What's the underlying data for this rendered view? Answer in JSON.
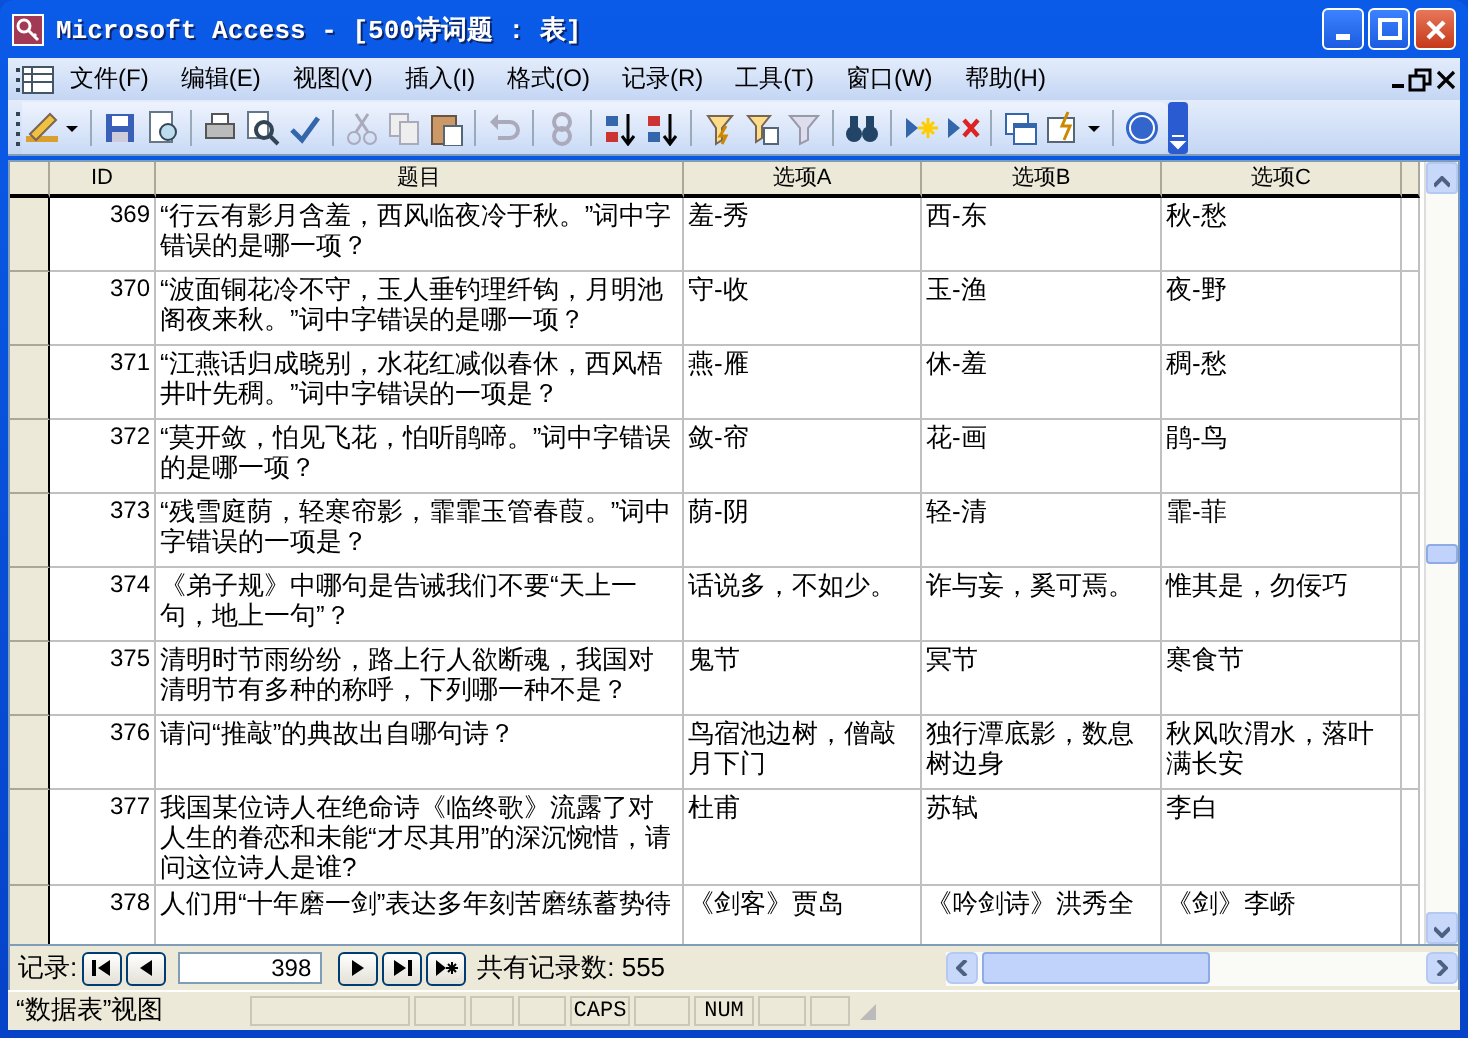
{
  "window": {
    "title": "Microsoft Access - [500诗词题 : 表]"
  },
  "menu": [
    {
      "label": "文件(F)"
    },
    {
      "label": "编辑(E)"
    },
    {
      "label": "视图(V)"
    },
    {
      "label": "插入(I)"
    },
    {
      "label": "格式(O)"
    },
    {
      "label": "记录(R)"
    },
    {
      "label": "工具(T)"
    },
    {
      "label": "窗口(W)"
    },
    {
      "label": "帮助(H)"
    }
  ],
  "table": {
    "columns": [
      "ID",
      "题目",
      "选项A",
      "选项B",
      "选项C"
    ],
    "rows": [
      {
        "id": "369",
        "question": "“行云有影月含羞，西风临夜冷于秋。”词中字错误的是哪一项？",
        "a": "羞-秀",
        "b": "西-东",
        "c": "秋-愁"
      },
      {
        "id": "370",
        "question": "“波面铜花冷不守，玉人垂钓理纤钩，月明池阁夜来秋。”词中字错误的是哪一项？",
        "a": "守-收",
        "b": "玉-渔",
        "c": "夜-野"
      },
      {
        "id": "371",
        "question": "“江燕话归成晓别，水花红减似春休，西风梧井叶先稠。”词中字错误的一项是？",
        "a": "燕-雁",
        "b": "休-羞",
        "c": "稠-愁"
      },
      {
        "id": "372",
        "question": "“莫开敛，怕见飞花，怕听鹃啼。”词中字错误的是哪一项？",
        "a": "敛-帘",
        "b": "花-画",
        "c": "鹃-鸟"
      },
      {
        "id": "373",
        "question": "“残雪庭荫，轻寒帘影，霏霏玉管春葭。”词中字错误的一项是？",
        "a": "荫-阴",
        "b": "轻-清",
        "c": "霏-菲"
      },
      {
        "id": "374",
        "question": "《弟子规》中哪句是告诫我们不要“天上一句，地上一句”？",
        "a": "话说多，不如少。",
        "b": "诈与妄，奚可焉。",
        "c": "惟其是，勿佞巧"
      },
      {
        "id": "375",
        "question": "清明时节雨纷纷，路上行人欲断魂，我国对清明节有多种的称呼，下列哪一种不是？",
        "a": "鬼节",
        "b": "冥节",
        "c": "寒食节"
      },
      {
        "id": "376",
        "question": "请问“推敲”的典故出自哪句诗？",
        "a": "鸟宿池边树，僧敲月下门",
        "b": "独行潭底影，数息树边身",
        "c": "秋风吹渭水，落叶满长安"
      },
      {
        "id": "377",
        "question": "我国某位诗人在绝命诗《临终歌》流露了对人生的眷恋和未能“才尽其用”的深沉惋惜，请问这位诗人是谁?",
        "a": "杜甫",
        "b": "苏轼",
        "c": "李白"
      },
      {
        "id": "378",
        "question": "人们用“十年磨一剑”表达多年刻苦磨练蓄势待",
        "a": "《剑客》贾岛",
        "b": "《吟剑诗》洪秀全",
        "c": "《剑》李峤"
      }
    ]
  },
  "navigation": {
    "label": "记录:",
    "current": "398",
    "total": "共有记录数: 555"
  },
  "status_bar": {
    "view": "“数据表”视图",
    "indicators": [
      {
        "label": "CAPS",
        "on": true
      },
      {
        "label": "NUM",
        "on": true
      }
    ]
  }
}
